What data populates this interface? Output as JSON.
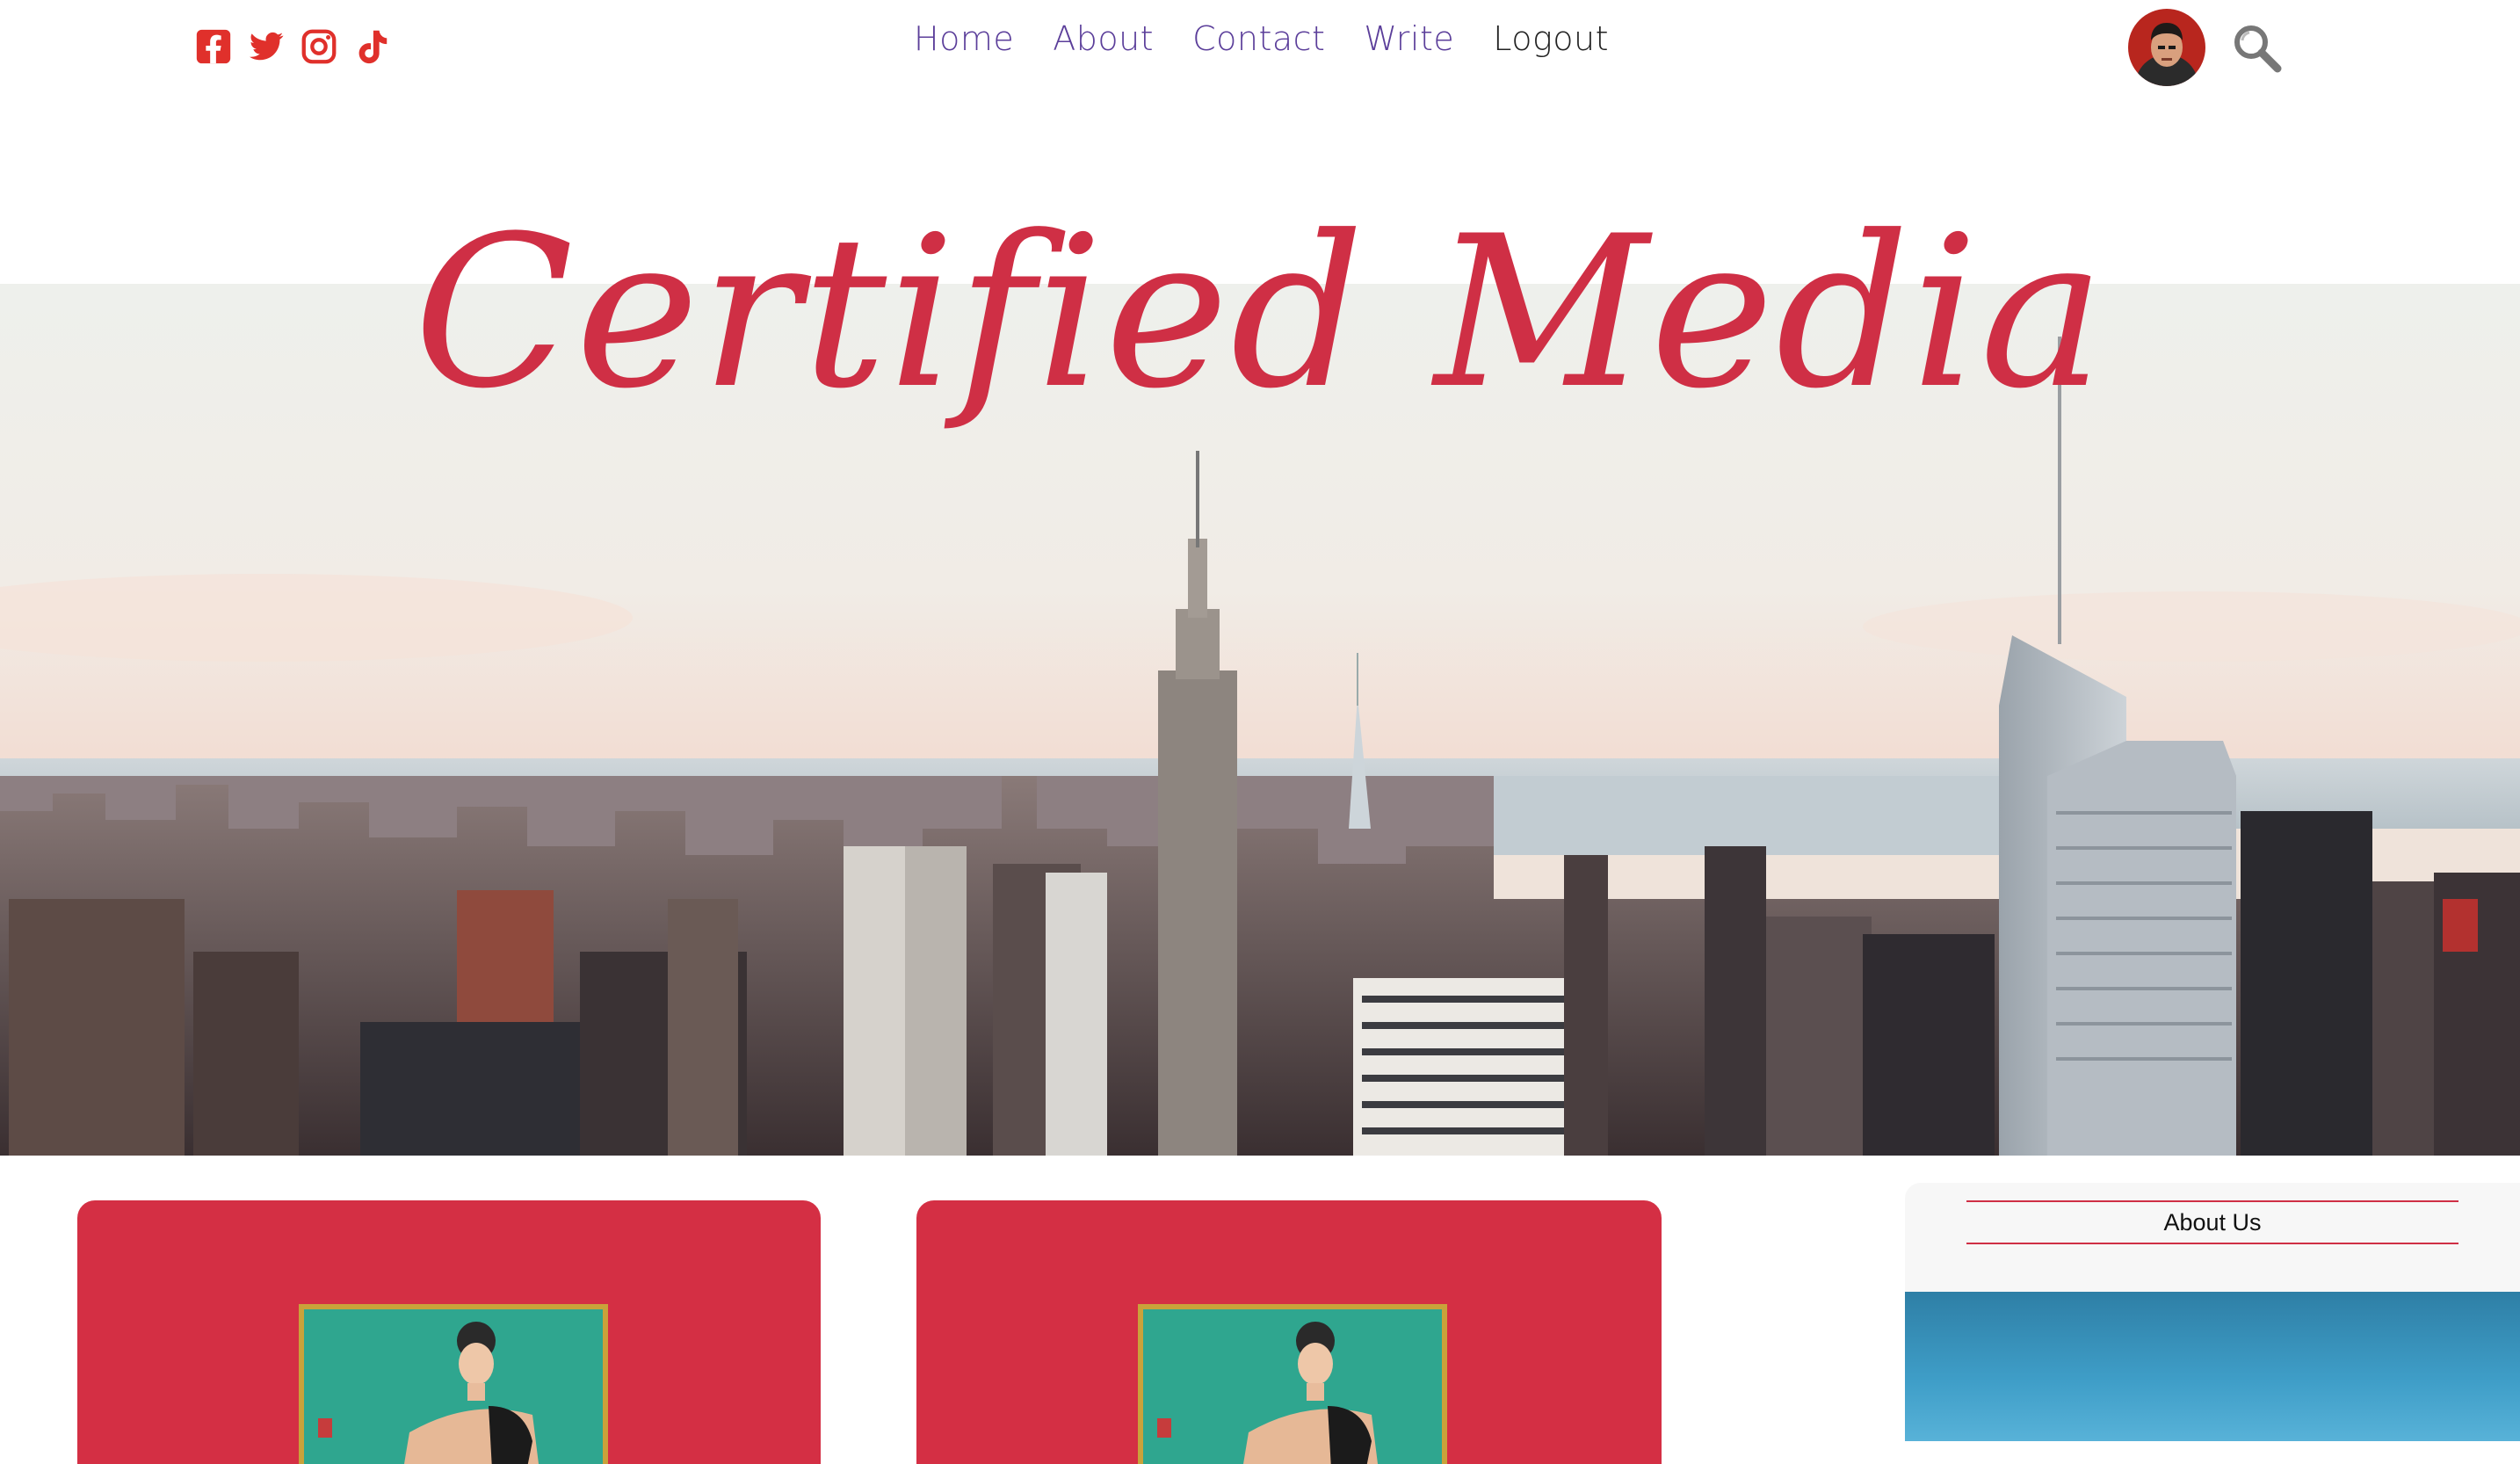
{
  "header": {
    "social": [
      {
        "name": "facebook-icon",
        "color": "#e0302b"
      },
      {
        "name": "twitter-icon",
        "color": "#e0302b"
      },
      {
        "name": "instagram-icon",
        "color": "#e0302b"
      },
      {
        "name": "tiktok-icon",
        "color": "#e0302b"
      }
    ],
    "nav": [
      "Home",
      "About",
      "Contact",
      "Write",
      "Logout"
    ],
    "nav_color": "#5b3e9a",
    "search_icon": "magnifier-icon"
  },
  "hero": {
    "title": "Certified Media",
    "title_color": "#cf2f45"
  },
  "posts": [
    {
      "card_color": "#d42f44"
    },
    {
      "card_color": "#d42f44"
    }
  ],
  "sidebar": {
    "title": "About Us",
    "accent": "#cf2f45"
  }
}
